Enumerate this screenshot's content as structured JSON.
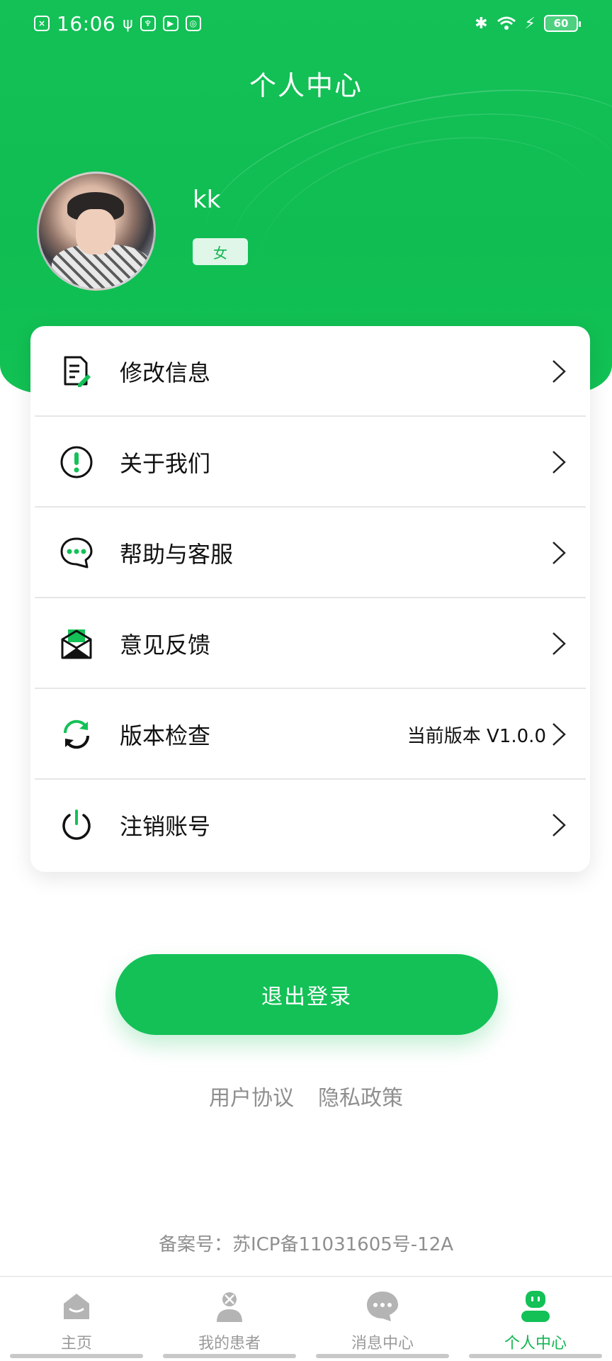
{
  "status_bar": {
    "time": "16:06",
    "battery": "60"
  },
  "header": {
    "title": "个人中心"
  },
  "profile": {
    "name": "kk",
    "gender": "女"
  },
  "menu": {
    "items": [
      {
        "label": "修改信息",
        "value": "",
        "icon": "edit-document-icon"
      },
      {
        "label": "关于我们",
        "value": "",
        "icon": "info-exclamation-icon"
      },
      {
        "label": "帮助与客服",
        "value": "",
        "icon": "chat-bubble-icon"
      },
      {
        "label": "意见反馈",
        "value": "",
        "icon": "mail-feedback-icon"
      },
      {
        "label": "版本检查",
        "value": "当前版本 V1.0.0",
        "icon": "refresh-icon"
      },
      {
        "label": "注销账号",
        "value": "",
        "icon": "power-icon"
      }
    ]
  },
  "actions": {
    "logout_label": "退出登录"
  },
  "legal": {
    "user_agreement": "用户协议",
    "privacy_policy": "隐私政策",
    "icp": "备案号：苏ICP备11031605号-12A"
  },
  "tabs": [
    {
      "label": "主页",
      "icon": "home-icon",
      "active": false
    },
    {
      "label": "我的患者",
      "icon": "patient-icon",
      "active": false
    },
    {
      "label": "消息中心",
      "icon": "message-icon",
      "active": false
    },
    {
      "label": "个人中心",
      "icon": "profile-icon",
      "active": true
    }
  ],
  "colors": {
    "brand_green": "#13c157",
    "text_gray": "#8f8f8f"
  }
}
